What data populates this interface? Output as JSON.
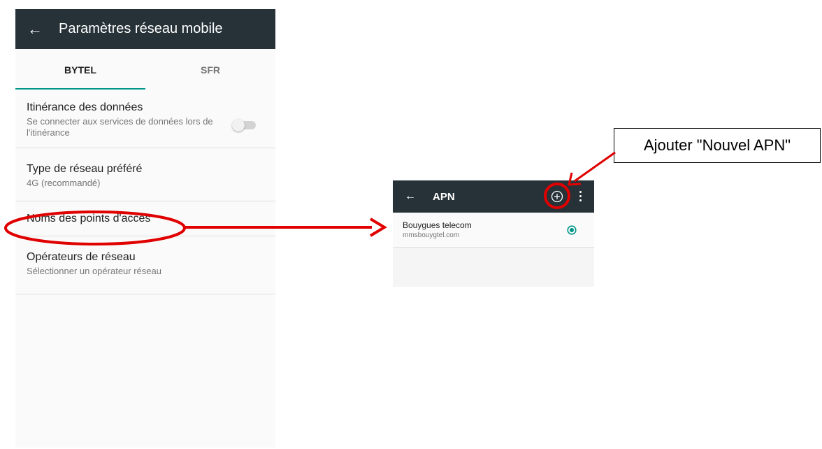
{
  "left_screen": {
    "title": "Paramètres réseau mobile",
    "back_icon": "←",
    "tabs": [
      {
        "label": "BYTEL",
        "selected": true
      },
      {
        "label": "SFR",
        "selected": false
      }
    ],
    "settings": [
      {
        "title": "Itinérance des données",
        "summary": "Se connecter aux services de données lors de l'itinérance",
        "toggle": false
      },
      {
        "title": "Type de réseau préféré",
        "summary": "4G (recommandé)"
      },
      {
        "title": "Noms des points d'accès"
      },
      {
        "title": "Opérateurs de réseau",
        "summary": "Sélectionner un opérateur réseau"
      }
    ]
  },
  "right_screen": {
    "title": "APN",
    "back_icon": "←",
    "apns": [
      {
        "name": "Bouygues telecom",
        "apn": "mmsbouygtel.com",
        "selected": true
      }
    ]
  },
  "annotation": {
    "callout_text": "Ajouter \"Nouvel APN\"",
    "highlight_color": "#e00000"
  },
  "colors": {
    "toolbar": "#263238",
    "accent": "#009688"
  }
}
